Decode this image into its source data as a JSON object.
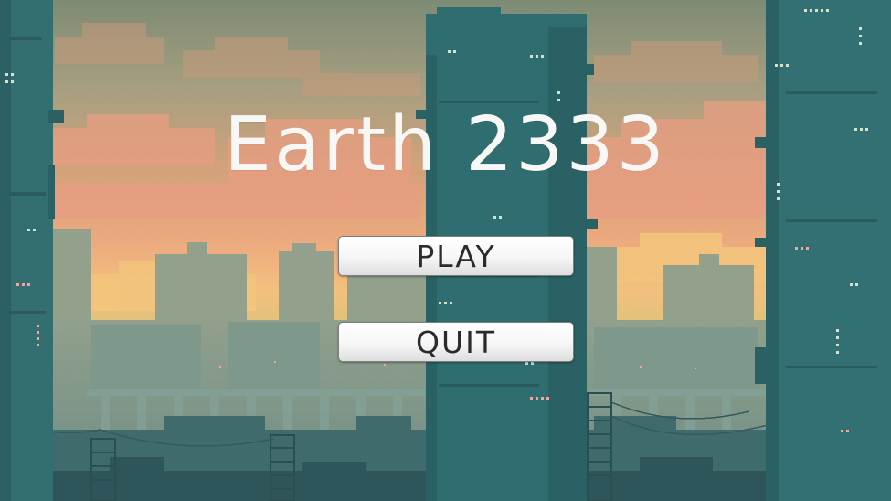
{
  "game": {
    "title": "Earth 2333"
  },
  "menu": {
    "play_label": "PLAY",
    "quit_label": "QUIT"
  },
  "palette": {
    "sky_top": "#7b8a72",
    "sky_mid": "#d6a97a",
    "sky_glow": "#f0b981",
    "horizon": "#f4cf7a",
    "tower_teal": "#2f6b6f",
    "far_buildings": "#8f9b86",
    "city_haze": "#7a9488",
    "ground_dark": "#2c5358",
    "window_light": "#f2a9a0",
    "window_pale": "#cfd9c4"
  }
}
